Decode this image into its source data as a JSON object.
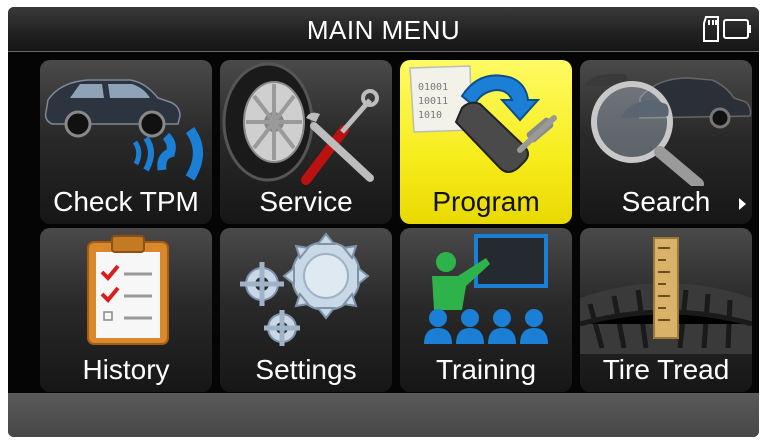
{
  "header": {
    "title": "MAIN MENU",
    "status_icons": [
      "sd-card-icon",
      "battery-icon"
    ]
  },
  "menu": {
    "selected": "Program",
    "tiles": [
      {
        "label": "Check TPM",
        "icon": "car-signal-icon"
      },
      {
        "label": "Service",
        "icon": "tire-tools-icon"
      },
      {
        "label": "Program",
        "icon": "sensor-program-icon"
      },
      {
        "label": "Search",
        "icon": "car-magnifier-icon"
      },
      {
        "label": "History",
        "icon": "clipboard-checklist-icon"
      },
      {
        "label": "Settings",
        "icon": "gears-icon"
      },
      {
        "label": "Training",
        "icon": "presentation-icon"
      },
      {
        "label": "Tire Tread",
        "icon": "tread-gauge-icon"
      }
    ]
  },
  "colors": {
    "selected_tile": "#f6ec1c",
    "tile": "#2a2a2a",
    "background": "#050505",
    "accent_blue": "#1b7fd6"
  }
}
